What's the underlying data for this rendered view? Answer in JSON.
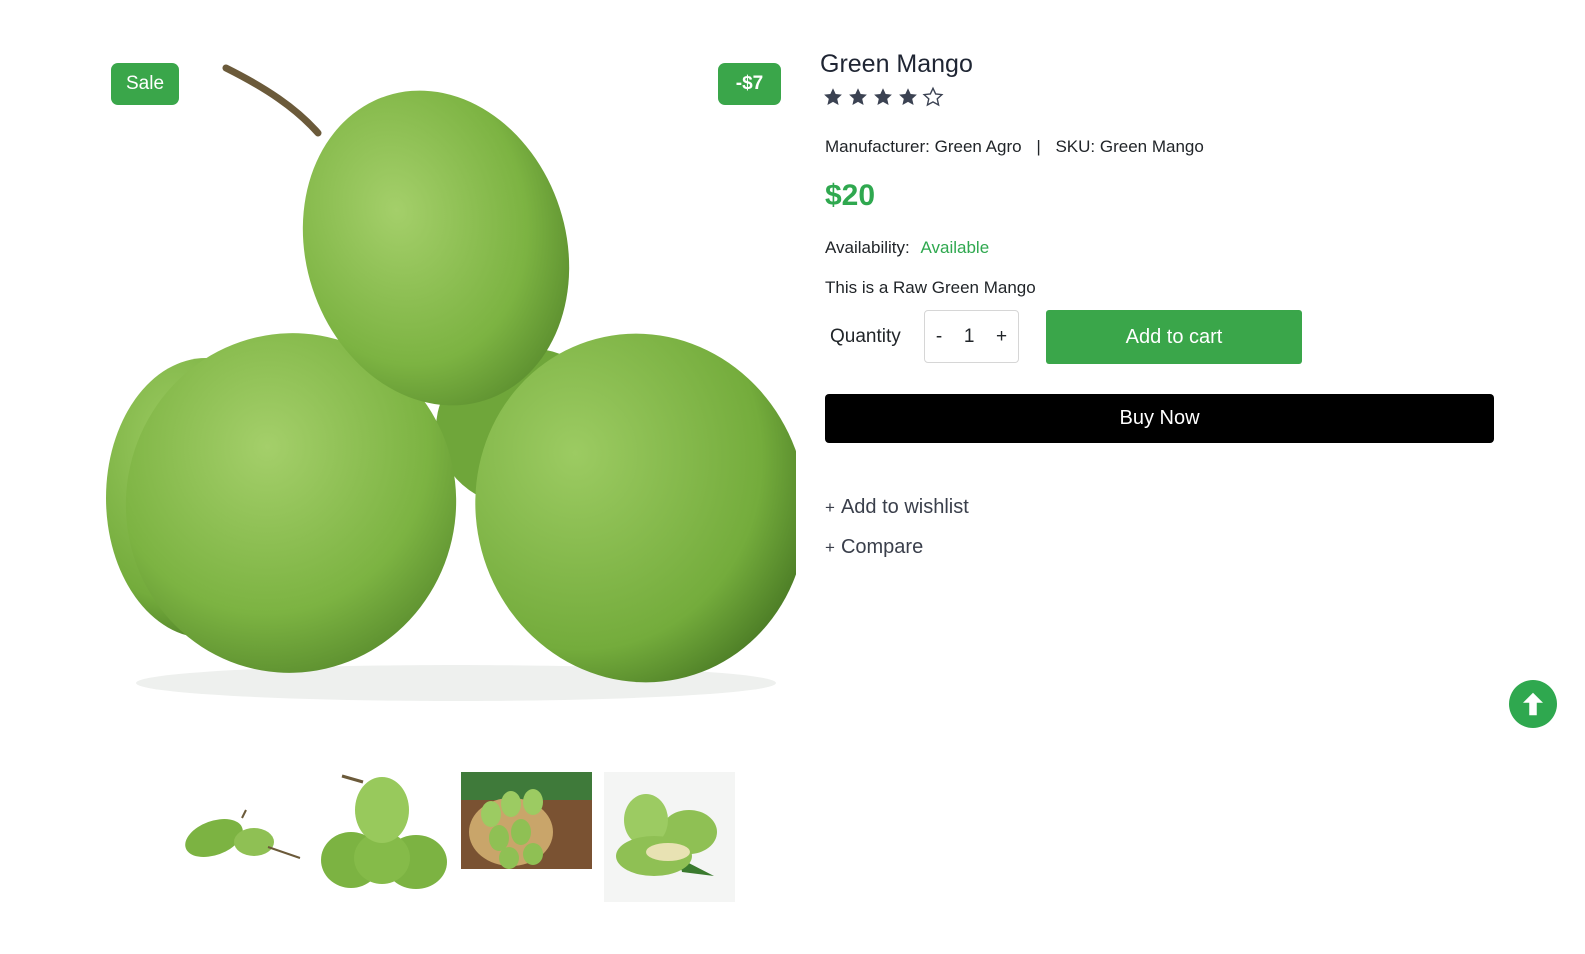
{
  "product": {
    "title": "Green Mango",
    "rating": 4,
    "rating_max": 5,
    "badges": {
      "sale": "Sale",
      "discount": "-$7"
    },
    "manufacturer_label": "Manufacturer:",
    "manufacturer": "Green Agro",
    "separator": "|",
    "sku_label": "SKU:",
    "sku": "Green Mango",
    "price": "$20",
    "availability_label": "Availability:",
    "availability": "Available",
    "description": "This is a Raw Green Mango"
  },
  "purchase": {
    "quantity_label": "Quantity",
    "decrement": "-",
    "quantity": "1",
    "increment": "+",
    "add_to_cart": "Add to cart",
    "buy_now": "Buy Now"
  },
  "actions": {
    "plus": "+",
    "wishlist": "Add to wishlist",
    "compare": "Compare"
  },
  "colors": {
    "accent": "#3aa64a",
    "price": "#2fa84f",
    "star": "#3b4252"
  },
  "icons": {
    "scroll_top": "arrow-up-circle-icon",
    "star": "star-icon"
  }
}
